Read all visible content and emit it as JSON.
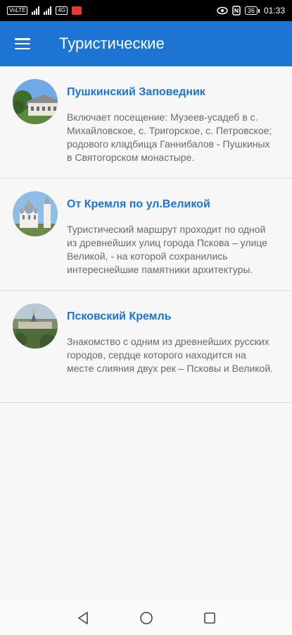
{
  "status_bar": {
    "left_chips": [
      "VoLTE",
      "4G"
    ],
    "time": "01:33",
    "battery": "36"
  },
  "app_bar": {
    "title": "Туристические",
    "menu_icon": "hamburger-menu-icon",
    "color": "#1e74d2"
  },
  "routes": [
    {
      "title": "Пушкинский Заповедник",
      "description": "Включает посещение: Музеев-усадеб в с. Михайловское, с. Тригорское, с. Петровское; родового кладбища Ганнибалов - Пушкиных в Святогорском монастыре.",
      "thumb": "estate-house-photo"
    },
    {
      "title": "От Кремля по ул.Великой",
      "description": "Туристический маршрут проходит по одной из древнейших улиц города Пскова – улице Великой, - на которой сохранились интереснейшие памятники архитектуры.",
      "thumb": "cathedral-photo"
    },
    {
      "title": "Псковский Кремль",
      "description": "Знакомство с одним из древнейших русских городов, сердце которого находится на месте слияния двух рек – Псковы и Великой.",
      "thumb": "kremlin-photo"
    }
  ],
  "nav_bar": {
    "back_icon": "back-triangle-icon",
    "home_icon": "home-circle-icon",
    "recents_icon": "recents-square-icon"
  },
  "colors": {
    "accent": "#1e74d2",
    "background": "#f7f7f7",
    "desc_text": "#6a6a6a"
  }
}
